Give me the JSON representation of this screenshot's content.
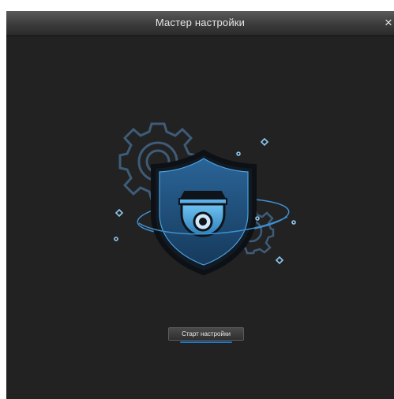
{
  "window": {
    "title": "Мастер настройки",
    "close_label": "×"
  },
  "illustration": {
    "icons": [
      "gear-icon",
      "shield-icon",
      "dome-camera-icon",
      "orbit-ring",
      "sparkle-icon"
    ],
    "colors": {
      "background": "#222222",
      "accent": "#5fb2ec",
      "shield_fill": "#1f4b72",
      "gear_outline": "#3f5f7a"
    }
  },
  "actions": {
    "start_label": "Старт настройки"
  }
}
